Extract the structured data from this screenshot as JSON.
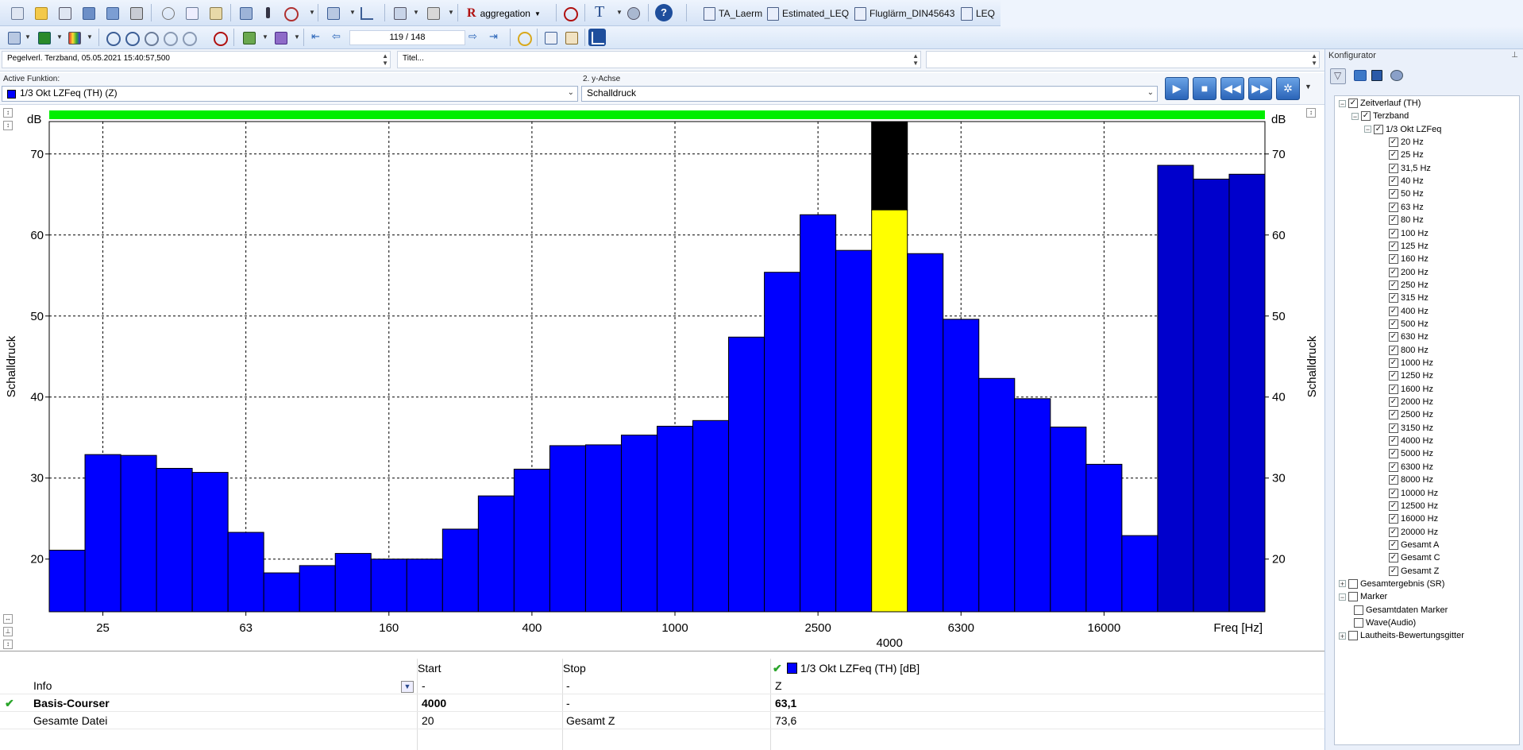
{
  "toolbar1": {
    "aggregation_label": "aggregation",
    "doc_tabs": [
      "TA_Laerm",
      "Estimated_LEQ",
      "Fluglärm_DIN45643",
      "LEQ"
    ]
  },
  "toolbar2": {
    "page_counter": "119 / 148"
  },
  "infobar": {
    "pegel": "Pegelverl. Terzband, 05.05.2021 15:40:57,500",
    "titel": "Titel..."
  },
  "funcbar": {
    "active_label": "Active Funktion:",
    "active_value": "1/3 Okt LZFeq (TH) (Z)",
    "yaxis_label": "2. y-Achse",
    "yaxis_value": "Schalldruck"
  },
  "colors": {
    "bar": "#0000ff",
    "selected": "#ffff00",
    "over": "#000000",
    "topbar": "#00ee00"
  },
  "chart_data": {
    "type": "bar",
    "unit_left": "dB",
    "unit_right": "dB",
    "ylabel": "Schalldruck",
    "xlabel": "Freq [Hz]",
    "ylim": [
      13.5,
      74
    ],
    "yticks": [
      20,
      30,
      40,
      50,
      60,
      70
    ],
    "categories": [
      "20",
      "25",
      "31,5",
      "40",
      "50",
      "63",
      "80",
      "100",
      "125",
      "160",
      "200",
      "250",
      "315",
      "400",
      "500",
      "630",
      "800",
      "1000",
      "1250",
      "1600",
      "2000",
      "2500",
      "3150",
      "4000",
      "5000",
      "6300",
      "8000",
      "10000",
      "12500",
      "16000",
      "20000",
      "Gesamt A",
      "Gesamt C",
      "Gesamt Z"
    ],
    "values": [
      21.1,
      32.9,
      32.8,
      31.2,
      30.7,
      23.3,
      18.3,
      19.2,
      20.7,
      20.0,
      20.0,
      23.7,
      27.8,
      31.1,
      34.0,
      34.1,
      35.3,
      36.4,
      37.1,
      47.4,
      55.4,
      62.5,
      58.1,
      74.0,
      57.7,
      49.6,
      42.3,
      39.8,
      36.3,
      31.7,
      22.9,
      68.6,
      66.9,
      67.5
    ],
    "selected_index": 23,
    "selected_value": 63.1,
    "xtick_labels": [
      "25",
      "63",
      "160",
      "400",
      "1000",
      "2500",
      "6300",
      "16000"
    ],
    "xtick_indices": [
      1,
      5,
      9,
      13,
      17,
      21,
      25,
      29
    ],
    "selected_label": "4000"
  },
  "table": {
    "headers": [
      "Start",
      "Stop",
      "1/3 Okt LZFeq (TH) [dB]"
    ],
    "rows": [
      {
        "name": "Info",
        "start": "-",
        "stop": "-",
        "value": "Z"
      },
      {
        "name": "Basis-Courser",
        "start": "4000",
        "stop": "-",
        "value": "63,1"
      },
      {
        "name": "Gesamte Datei",
        "start": "20",
        "stop": "Gesamt Z",
        "value": "73,6"
      }
    ]
  },
  "konfig": {
    "title": "Konfigurator",
    "tree": [
      {
        "label": "Zeitverlauf (TH)",
        "level": 0,
        "checked": true,
        "expander": "−"
      },
      {
        "label": "Terzband",
        "level": 1,
        "checked": true,
        "expander": "−"
      },
      {
        "label": "1/3 Okt LZFeq",
        "level": 2,
        "checked": true,
        "expander": "−"
      },
      {
        "label": "20 Hz",
        "level": 3,
        "checked": true
      },
      {
        "label": "25 Hz",
        "level": 3,
        "checked": true
      },
      {
        "label": "31,5 Hz",
        "level": 3,
        "checked": true
      },
      {
        "label": "40 Hz",
        "level": 3,
        "checked": true
      },
      {
        "label": "50 Hz",
        "level": 3,
        "checked": true
      },
      {
        "label": "63 Hz",
        "level": 3,
        "checked": true
      },
      {
        "label": "80 Hz",
        "level": 3,
        "checked": true
      },
      {
        "label": "100 Hz",
        "level": 3,
        "checked": true
      },
      {
        "label": "125 Hz",
        "level": 3,
        "checked": true
      },
      {
        "label": "160 Hz",
        "level": 3,
        "checked": true
      },
      {
        "label": "200 Hz",
        "level": 3,
        "checked": true
      },
      {
        "label": "250 Hz",
        "level": 3,
        "checked": true
      },
      {
        "label": "315 Hz",
        "level": 3,
        "checked": true
      },
      {
        "label": "400 Hz",
        "level": 3,
        "checked": true
      },
      {
        "label": "500 Hz",
        "level": 3,
        "checked": true
      },
      {
        "label": "630 Hz",
        "level": 3,
        "checked": true
      },
      {
        "label": "800 Hz",
        "level": 3,
        "checked": true
      },
      {
        "label": "1000 Hz",
        "level": 3,
        "checked": true
      },
      {
        "label": "1250 Hz",
        "level": 3,
        "checked": true
      },
      {
        "label": "1600 Hz",
        "level": 3,
        "checked": true
      },
      {
        "label": "2000 Hz",
        "level": 3,
        "checked": true
      },
      {
        "label": "2500 Hz",
        "level": 3,
        "checked": true
      },
      {
        "label": "3150 Hz",
        "level": 3,
        "checked": true
      },
      {
        "label": "4000 Hz",
        "level": 3,
        "checked": true
      },
      {
        "label": "5000 Hz",
        "level": 3,
        "checked": true
      },
      {
        "label": "6300 Hz",
        "level": 3,
        "checked": true
      },
      {
        "label": "8000 Hz",
        "level": 3,
        "checked": true
      },
      {
        "label": "10000 Hz",
        "level": 3,
        "checked": true
      },
      {
        "label": "12500 Hz",
        "level": 3,
        "checked": true
      },
      {
        "label": "16000 Hz",
        "level": 3,
        "checked": true
      },
      {
        "label": "20000 Hz",
        "level": 3,
        "checked": true
      },
      {
        "label": "Gesamt A",
        "level": 3,
        "checked": true
      },
      {
        "label": "Gesamt C",
        "level": 3,
        "checked": true
      },
      {
        "label": "Gesamt Z",
        "level": 3,
        "checked": true
      },
      {
        "label": "Gesamtergebnis (SR)",
        "level": 0,
        "checked": false,
        "expander": "+"
      },
      {
        "label": "Marker",
        "level": 0,
        "checked": false,
        "expander": "−"
      },
      {
        "label": "Gesamtdaten Marker",
        "level": 1,
        "checked": false
      },
      {
        "label": "Wave(Audio)",
        "level": 1,
        "checked": false
      },
      {
        "label": "Lautheits-Bewertungsgitter",
        "level": 0,
        "checked": false,
        "expander": "+"
      }
    ]
  }
}
